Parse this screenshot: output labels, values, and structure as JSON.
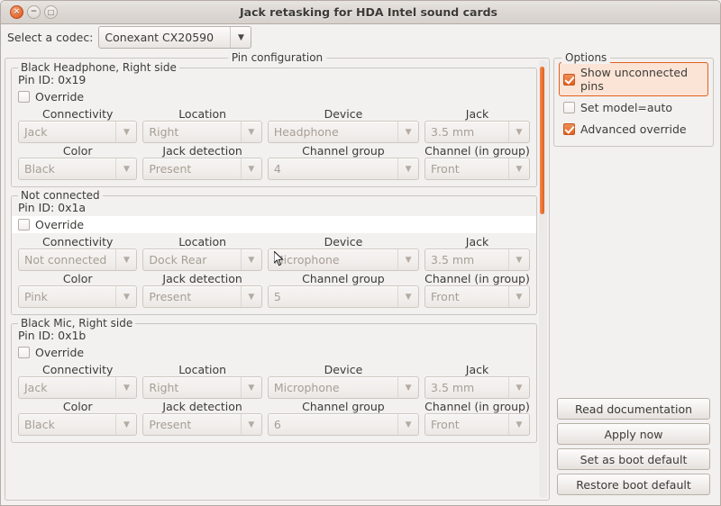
{
  "window": {
    "title": "Jack retasking for HDA Intel sound cards",
    "buttons": {
      "close": "close-button",
      "minimize": "minimize-button",
      "maximize": "maximize-button"
    },
    "close_glyph": "×",
    "minimize_glyph": "−",
    "maximize_glyph": "□"
  },
  "codec": {
    "label": "Select a codec:",
    "value": "Conexant CX20590",
    "arrow": "▼"
  },
  "pin_configuration": {
    "title": "Pin configuration",
    "column_headers_row1": [
      "Connectivity",
      "Location",
      "Device",
      "Jack"
    ],
    "column_headers_row2": [
      "Color",
      "Jack detection",
      "Channel group",
      "Channel (in group)"
    ],
    "override_label": "Override",
    "arrow": "▼",
    "groups": [
      {
        "title": "Black Headphone, Right side",
        "pin_id": "Pin ID: 0x19",
        "override_checked": false,
        "override_hover": false,
        "connectivity": "Jack",
        "location": "Right",
        "device": "Headphone",
        "jack": "3.5 mm",
        "color": "Black",
        "jack_detection": "Present",
        "channel_group": "4",
        "channel_in_group": "Front"
      },
      {
        "title": "Not connected",
        "pin_id": "Pin ID: 0x1a",
        "override_checked": false,
        "override_hover": true,
        "connectivity": "Not connected",
        "location": "Dock Rear",
        "device": "Microphone",
        "jack": "3.5 mm",
        "color": "Pink",
        "jack_detection": "Present",
        "channel_group": "5",
        "channel_in_group": "Front"
      },
      {
        "title": "Black Mic, Right side",
        "pin_id": "Pin ID: 0x1b",
        "override_checked": false,
        "override_hover": false,
        "connectivity": "Jack",
        "location": "Right",
        "device": "Microphone",
        "jack": "3.5 mm",
        "color": "Black",
        "jack_detection": "Present",
        "channel_group": "6",
        "channel_in_group": "Front"
      }
    ]
  },
  "options": {
    "title": "Options",
    "items": [
      {
        "label": "Show unconnected pins",
        "checked": true,
        "focused": true
      },
      {
        "label": "Set model=auto",
        "checked": false,
        "focused": false
      },
      {
        "label": "Advanced override",
        "checked": true,
        "focused": false
      }
    ]
  },
  "actions": [
    {
      "label": "Read documentation"
    },
    {
      "label": "Apply now"
    },
    {
      "label": "Set as boot default"
    },
    {
      "label": "Restore boot default"
    }
  ],
  "colors": {
    "accent": "#e2611f",
    "window_bg": "#f2f1f0",
    "frame_border": "#ccc5bf",
    "text": "#3c3b37",
    "disabled_text": "#a79e95",
    "focus_bg": "#fbe4d6"
  }
}
